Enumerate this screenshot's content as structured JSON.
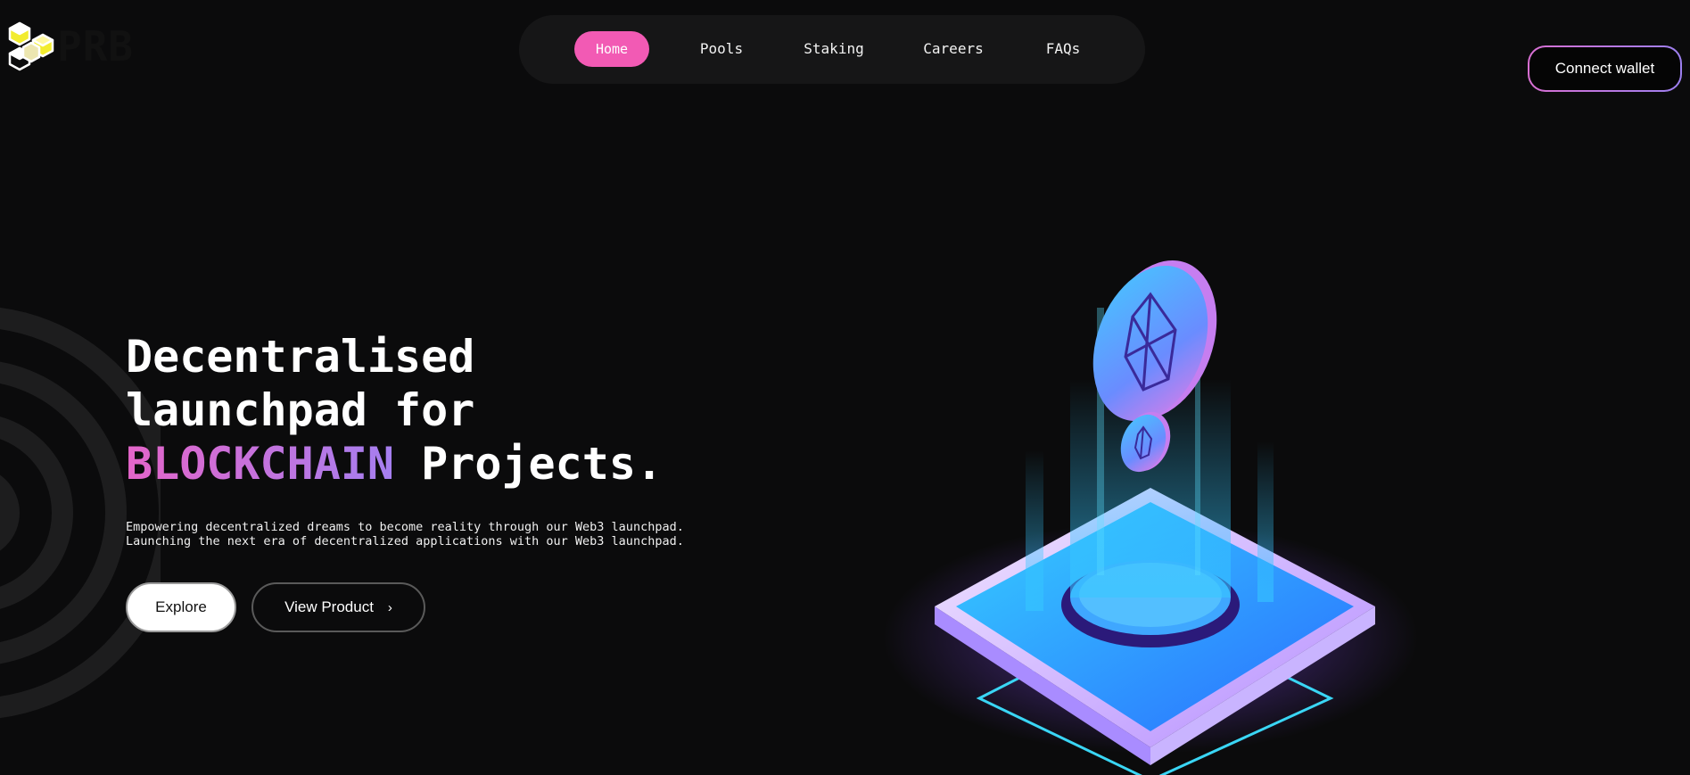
{
  "brand": {
    "name": "PRB"
  },
  "nav": {
    "items": [
      {
        "label": "Home",
        "active": true
      },
      {
        "label": "Pools",
        "active": false
      },
      {
        "label": "Staking",
        "active": false
      },
      {
        "label": "Careers",
        "active": false
      },
      {
        "label": "FAQs",
        "active": false
      }
    ]
  },
  "header": {
    "connect_label": "Connect wallet"
  },
  "hero": {
    "title_line1": "Decentralised",
    "title_line2": "launchpad for",
    "title_accent": "BLOCKCHAIN",
    "title_rest": " Projects.",
    "subtitle_line1": "Empowering decentralized dreams to become reality through our Web3 launchpad.",
    "subtitle_line2": "Launching the next era of decentralized applications with our Web3 launchpad.",
    "explore_label": "Explore",
    "view_product_label": "View Product"
  },
  "icons": {
    "logo": "hexagon-cube-logo-icon",
    "chevron": "chevron-right-icon",
    "illustration": "eos-coin-platform-illustration"
  },
  "colors": {
    "background": "#0b0b0c",
    "accent_pink": "#f25ab4",
    "gradient_start": "#e465c9",
    "gradient_end": "#a57ff0",
    "nav_bg": "#161617"
  }
}
